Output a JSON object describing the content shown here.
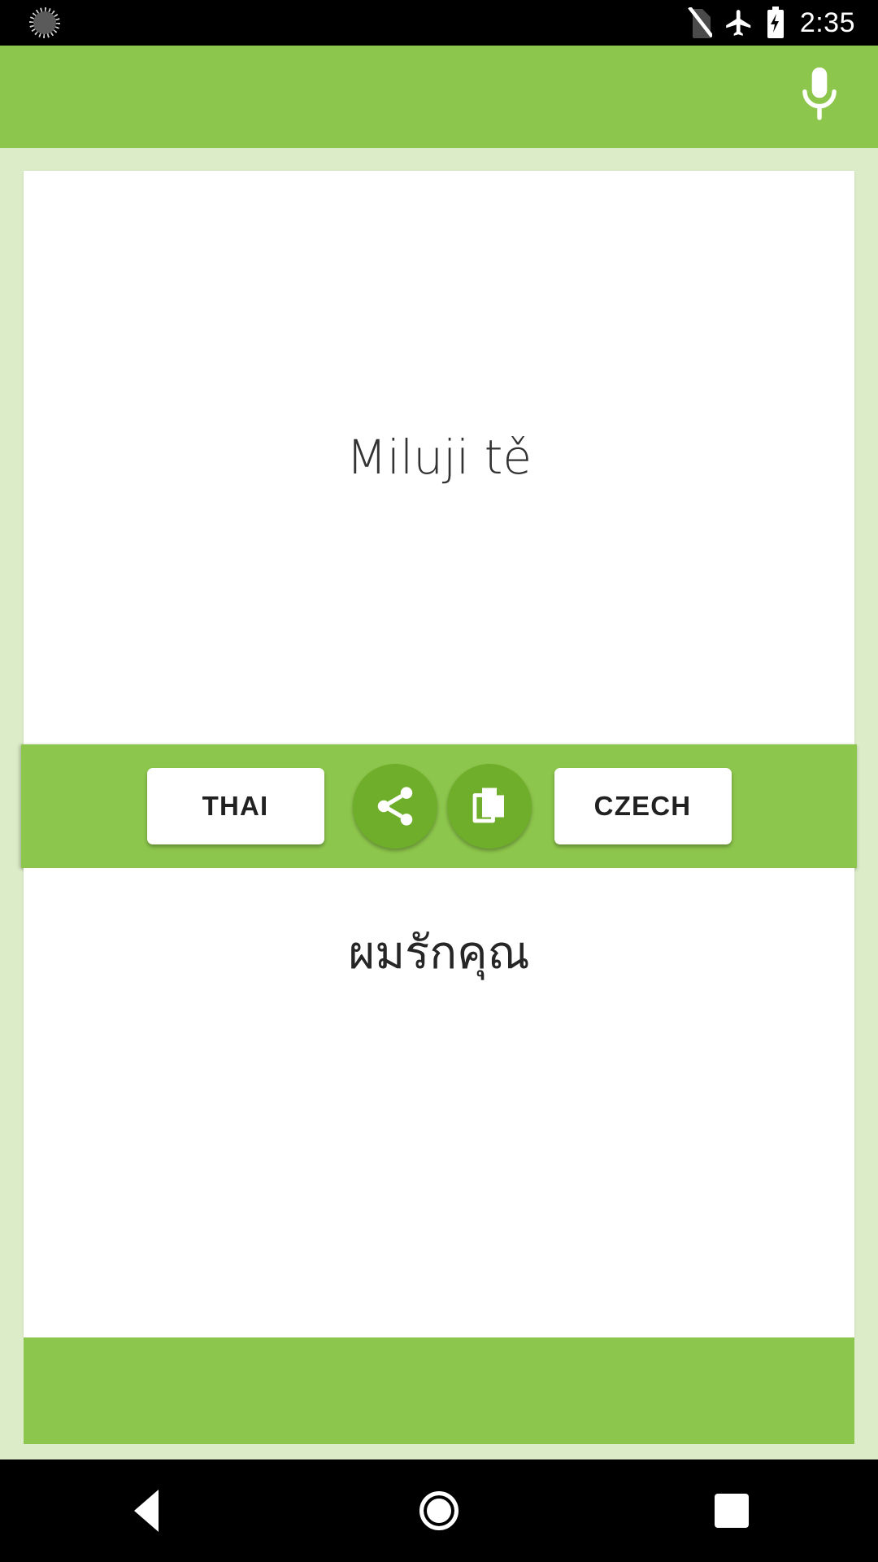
{
  "status_bar": {
    "notification_icon": "sun-notification-icon",
    "icons": [
      "no-sim-icon",
      "airplane-mode-icon",
      "battery-charging-icon"
    ],
    "time": "2:35"
  },
  "app_bar": {
    "mic_icon": "microphone-icon",
    "background_color": "#8dc64c"
  },
  "source_panel": {
    "text": "Miluji tě",
    "language": "Czech"
  },
  "action_bar": {
    "source_language_label": "THAI",
    "target_language_label": "CZECH",
    "share_icon": "share-icon",
    "copy_icon": "copy-icon"
  },
  "target_panel": {
    "text": "ผมรักคุณ",
    "language": "Thai"
  },
  "navigation_bar": {
    "back_label": "back-icon",
    "home_label": "home-icon",
    "recents_label": "recents-icon"
  },
  "colors": {
    "accent_green": "#8dc64c",
    "dark_green": "#6fae2a",
    "page_background": "#dcecc8",
    "card_background": "#ffffff"
  }
}
